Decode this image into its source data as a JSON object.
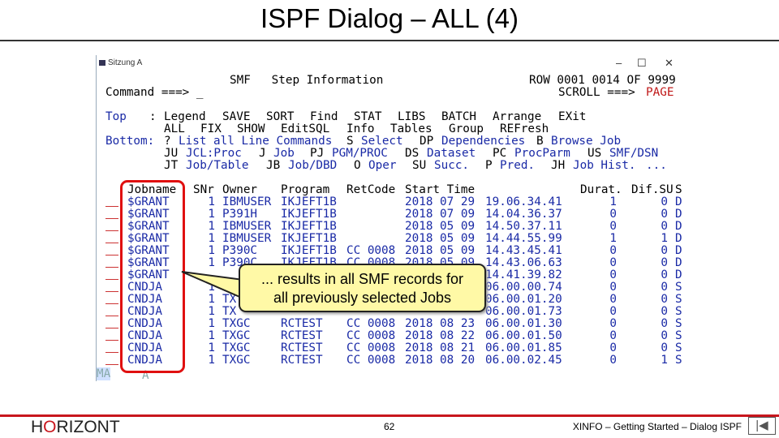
{
  "slide": {
    "title": "ISPF Dialog – ALL (4)",
    "logo": "HORIZONT",
    "page": "62",
    "footer": "XINFO – Getting Started – Dialog ISPF",
    "nav_icon": "first-page-icon"
  },
  "window": {
    "title": "Sitzung A",
    "minimize": "–",
    "maximize": "☐",
    "close": "✕"
  },
  "screen": {
    "panel_title": "SMF   Step Information",
    "row_info": "ROW 0001 0014 OF 9999",
    "command_label": "Command ===> _",
    "scroll_label": "SCROLL ===>",
    "scroll_value": "PAGE",
    "menu": [
      [
        {
          "t": "Top",
          "c": "b"
        },
        {
          "t": ":",
          "c": "k"
        },
        {
          "t": "Legend",
          "c": "k"
        },
        {
          "t": "SAVE",
          "c": "k"
        },
        {
          "t": "SORT",
          "c": "k"
        },
        {
          "t": "Find",
          "c": "k"
        },
        {
          "t": "STAT",
          "c": "k"
        },
        {
          "t": "LIBS",
          "c": "k"
        },
        {
          "t": "BATCH",
          "c": "k"
        },
        {
          "t": "Arrange",
          "c": "k"
        },
        {
          "t": "EXit",
          "c": "k"
        }
      ],
      [
        {
          "t": "ALL",
          "c": "k"
        },
        {
          "t": "FIX",
          "c": "k"
        },
        {
          "t": "SHOW",
          "c": "k"
        },
        {
          "t": "EditSQL",
          "c": "k"
        },
        {
          "t": "Info",
          "c": "k"
        },
        {
          "t": "Tables",
          "c": "k"
        },
        {
          "t": "Group",
          "c": "k"
        },
        {
          "t": "REFresh",
          "c": "k"
        }
      ],
      [
        {
          "t": "Bottom:",
          "c": "b"
        },
        {
          "t": "?",
          "c": "k"
        },
        {
          "t": "List all Line Commands",
          "c": "b"
        },
        {
          "t": "S",
          "c": "k"
        },
        {
          "t": "Select",
          "c": "b"
        },
        {
          "t": "DP",
          "c": "k"
        },
        {
          "t": "Dependencies",
          "c": "b"
        },
        {
          "t": "B",
          "c": "k"
        },
        {
          "t": "Browse Job",
          "c": "b"
        }
      ],
      [
        {
          "t": "JU",
          "c": "k"
        },
        {
          "t": "JCL:Proc",
          "c": "b"
        },
        {
          "t": "J",
          "c": "k"
        },
        {
          "t": "Job",
          "c": "b"
        },
        {
          "t": "PJ",
          "c": "k"
        },
        {
          "t": "PGM/PROC",
          "c": "b"
        },
        {
          "t": "DS",
          "c": "k"
        },
        {
          "t": "Dataset",
          "c": "b"
        },
        {
          "t": "PC",
          "c": "k"
        },
        {
          "t": "ProcParm",
          "c": "b"
        },
        {
          "t": "US",
          "c": "k"
        },
        {
          "t": "SMF/DSN",
          "c": "b"
        }
      ],
      [
        {
          "t": "JT",
          "c": "k"
        },
        {
          "t": "Job/Table",
          "c": "b"
        },
        {
          "t": "JB",
          "c": "k"
        },
        {
          "t": "Job/DBD",
          "c": "b"
        },
        {
          "t": "O",
          "c": "k"
        },
        {
          "t": "Oper",
          "c": "b"
        },
        {
          "t": "SU",
          "c": "k"
        },
        {
          "t": "Succ.",
          "c": "b"
        },
        {
          "t": "P",
          "c": "k"
        },
        {
          "t": "Pred.",
          "c": "b"
        },
        {
          "t": "JH",
          "c": "k"
        },
        {
          "t": "Job Hist.",
          "c": "b"
        },
        {
          "t": "...",
          "c": "b"
        }
      ]
    ],
    "columns": [
      "Jobname",
      "SNr",
      "Owner",
      "Program",
      "RetCode",
      "Start Time",
      "Durat.",
      "Dif.SU",
      "S"
    ],
    "rows": [
      [
        "$GRANT",
        "1",
        "IBMUSER",
        "IKJEFT1B",
        "",
        "2018 07 29",
        "19.06.34.41",
        "1",
        "0",
        "D"
      ],
      [
        "$GRANT",
        "1",
        "P391H",
        "IKJEFT1B",
        "",
        "2018 07 09",
        "14.04.36.37",
        "0",
        "0",
        "D"
      ],
      [
        "$GRANT",
        "1",
        "IBMUSER",
        "IKJEFT1B",
        "",
        "2018 05 09",
        "14.50.37.11",
        "0",
        "0",
        "D"
      ],
      [
        "$GRANT",
        "1",
        "IBMUSER",
        "IKJEFT1B",
        "",
        "2018 05 09",
        "14.44.55.99",
        "1",
        "1",
        "D"
      ],
      [
        "$GRANT",
        "1",
        "P390C",
        "IKJEFT1B",
        "CC 0008",
        "2018 05 09",
        "14.43.45.41",
        "0",
        "0",
        "D"
      ],
      [
        "$GRANT",
        "1",
        "P390C",
        "IKJEFT1B",
        "CC 0008",
        "2018 05 09",
        "14.43.06.63",
        "0",
        "0",
        "D"
      ],
      [
        "$GRANT",
        "",
        "",
        "",
        "",
        "",
        "14.41.39.82",
        "0",
        "0",
        "D"
      ],
      [
        "CNDJA",
        "1",
        "TX",
        "",
        "",
        "",
        "06.00.00.74",
        "0",
        "0",
        "S"
      ],
      [
        "CNDJA",
        "1",
        "TX",
        "",
        "",
        "",
        "06.00.01.20",
        "0",
        "0",
        "S"
      ],
      [
        "CNDJA",
        "1",
        "TX",
        "",
        "",
        "",
        "06.00.01.73",
        "0",
        "0",
        "S"
      ],
      [
        "CNDJA",
        "1",
        "TXGC",
        "RCTEST",
        "CC 0008",
        "2018 08 23",
        "06.00.01.30",
        "0",
        "0",
        "S"
      ],
      [
        "CNDJA",
        "1",
        "TXGC",
        "RCTEST",
        "CC 0008",
        "2018 08 22",
        "06.00.01.50",
        "0",
        "0",
        "S"
      ],
      [
        "CNDJA",
        "1",
        "TXGC",
        "RCTEST",
        "CC 0008",
        "2018 08 21",
        "06.00.01.85",
        "0",
        "0",
        "S"
      ],
      [
        "CNDJA",
        "1",
        "TXGC",
        "RCTEST",
        "CC 0008",
        "2018 08 20",
        "06.00.02.45",
        "0",
        "1",
        "S"
      ]
    ],
    "status_left": "MA",
    "status_mid": "A"
  },
  "callout": {
    "line1": "... results in all SMF records for",
    "line2": "all previously selected Jobs"
  }
}
